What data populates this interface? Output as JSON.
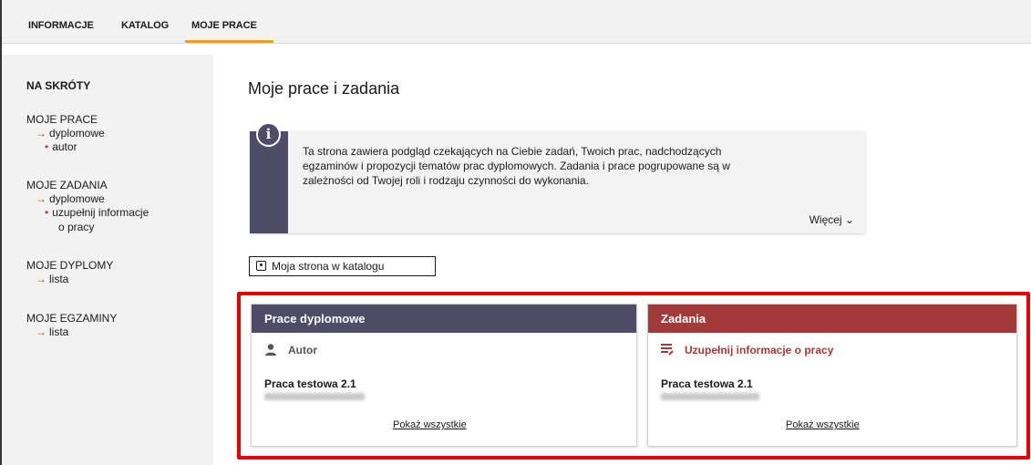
{
  "nav": {
    "tabs": [
      "INFORMACJE",
      "KATALOG",
      "MOJE PRACE"
    ],
    "active_tab": "MOJE PRACE",
    "accent": "#e8a02c"
  },
  "sidebar": {
    "heading": "NA SKRÓTY",
    "groups": [
      {
        "title": "MOJE PRACE",
        "items": [
          "dyplomowe",
          "autor"
        ]
      },
      {
        "title": "MOJE ZADANIA",
        "items": [
          "dyplomowe",
          "uzupełnij informacje",
          "o pracy"
        ]
      },
      {
        "title": "MOJE DYPLOMY",
        "items": [
          "lista"
        ]
      },
      {
        "title": "MOJE EGZAMINY",
        "items": [
          "lista"
        ]
      }
    ]
  },
  "main": {
    "title": "Moje prace i zadania",
    "info": {
      "lines": [
        "Ta strona zawiera podgląd czekających na Ciebie zadań, Twoich prac, nadchodzących",
        "egzaminów i propozycji tematów prac dyplomowych. Zadania i prace pogrupowane są w",
        "zależności od Twojej roli i rodzaju czynności do wykonania."
      ],
      "more_label": "Więcej ⌄"
    },
    "catalog_button": "Moja strona w katalogu",
    "cards": [
      {
        "header": "Prace dyplomowe",
        "header_color": "#4e4c66",
        "role": "Autor",
        "work": "Praca testowa 2.1",
        "show_all": "Pokaż wszystkie"
      },
      {
        "header": "Zadania",
        "header_color": "#a33a3a",
        "role": "Uzupełnij informacje o pracy",
        "work": "Praca testowa 2.1",
        "show_all": "Pokaż wszystkie"
      }
    ],
    "highlight_color": "#e60000"
  }
}
